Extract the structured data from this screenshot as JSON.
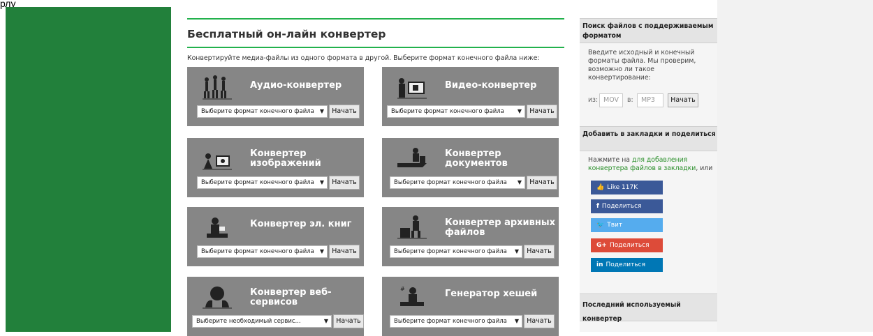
{
  "page_fragment": "рлу",
  "main": {
    "title": "Бесплатный он-лайн конвертер",
    "description": "Конвертируйте медиа-файлы из одного формата в другой. Выберите формат конечного файла ниже:",
    "cards": [
      {
        "title": "Аудио-конвертер",
        "select": "Выберите формат конечного файла",
        "button": "Начать",
        "icon": "audio-people-icon"
      },
      {
        "title": "Видео-конвертер",
        "select": "Выберите формат конечного файла",
        "button": "Начать",
        "icon": "video-camera-icon"
      },
      {
        "title": "Конвертер изображений",
        "select": "Выберите формат конечного файла",
        "button": "Начать",
        "icon": "image-photographer-icon"
      },
      {
        "title": "Конвертер документов",
        "select": "Выберите формат конечного файла",
        "button": "Начать",
        "icon": "document-desk-icon"
      },
      {
        "title": "Конвертер эл. книг",
        "select": "Выберите формат конечного файла",
        "button": "Начать",
        "icon": "ebook-reader-icon"
      },
      {
        "title": "Конвертер архивных файлов",
        "select": "Выберите формат конечного файла",
        "button": "Начать",
        "icon": "archive-worker-icon"
      },
      {
        "title": "Конвертер веб-сервисов",
        "select": "Выберите необходимый сервис...",
        "button": "Начать",
        "icon": "globe-hands-icon"
      },
      {
        "title": "Генератор хешей",
        "select": "Выберите формат конечного файла",
        "button": "Начать",
        "icon": "hash-person-icon"
      }
    ]
  },
  "sidebar": {
    "search": {
      "heading": "Поиск файлов с поддерживаемым форматом",
      "text": "Введите исходный и конечный форматы файла. Мы проверим, возможно ли такое конвертирование:",
      "from_label": "из:",
      "from_placeholder": "MOV",
      "to_label": "в:",
      "to_placeholder": "MP3",
      "button": "Начать"
    },
    "bookmark": {
      "heading": "Добавить в закладки и поделиться",
      "text_before": "Нажмите на ",
      "link": "для добавления конвертера файлов в закладки",
      "text_after": ", или"
    },
    "share_buttons": [
      {
        "icon": "like-thumb-icon",
        "glyph": "👍",
        "label": "Like 117K",
        "color": "#3b5998"
      },
      {
        "icon": "facebook-icon",
        "glyph": "f",
        "label": "Поделиться",
        "color": "#3b5998"
      },
      {
        "icon": "twitter-icon",
        "glyph": "🐦",
        "label": "Твит",
        "color": "#55acee"
      },
      {
        "icon": "googleplus-icon",
        "glyph": "G+",
        "label": "Поделиться",
        "color": "#dd4b39"
      },
      {
        "icon": "linkedin-icon",
        "glyph": "in",
        "label": "Поделиться",
        "color": "#0077b5"
      }
    ],
    "last": {
      "heading": "Последний используемый конвертер"
    }
  }
}
